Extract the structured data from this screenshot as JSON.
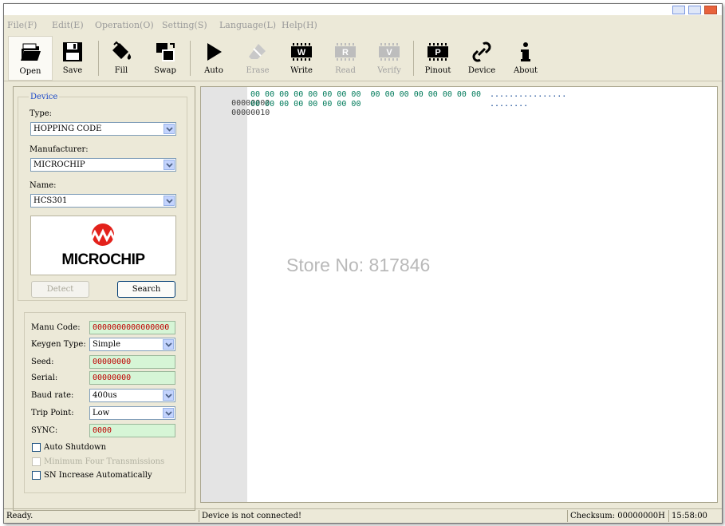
{
  "menu": {
    "items": [
      "File(F)",
      "Edit(E)",
      "Operation(O)",
      "Setting(S)",
      "Language(L)",
      "Help(H)"
    ]
  },
  "toolbar": {
    "buttons": [
      {
        "label": "Open",
        "icon": "folder-open-icon"
      },
      {
        "label": "Save",
        "icon": "floppy-disk-icon"
      },
      {
        "label": "Fill",
        "icon": "paint-bucket-icon"
      },
      {
        "label": "Swap",
        "icon": "swap-icon"
      },
      {
        "label": "Auto",
        "icon": "play-icon"
      },
      {
        "label": "Erase",
        "icon": "eraser-icon"
      },
      {
        "label": "Write",
        "icon": "chip-w-icon",
        "chip": "W"
      },
      {
        "label": "Read",
        "icon": "chip-r-icon",
        "chip": "R"
      },
      {
        "label": "Verify",
        "icon": "chip-v-icon",
        "chip": "V"
      },
      {
        "label": "Pinout",
        "icon": "chip-p-icon",
        "chip": "P"
      },
      {
        "label": "Device",
        "icon": "link-icon"
      },
      {
        "label": "About",
        "icon": "info-icon"
      }
    ]
  },
  "device": {
    "group_title": "Device",
    "type_label": "Type:",
    "type_value": "HOPPING CODE",
    "manufacturer_label": "Manufacturer:",
    "manufacturer_value": "MICROCHIP",
    "name_label": "Name:",
    "name_value": "HCS301",
    "logo_text": "MICROCHIP",
    "detect_label": "Detect",
    "search_label": "Search"
  },
  "params": {
    "manu_code_label": "Manu Code:",
    "manu_code_value": "0000000000000000",
    "keygen_label": "Keygen Type:",
    "keygen_value": "Simple",
    "seed_label": "Seed:",
    "seed_value": "00000000",
    "serial_label": "Serial:",
    "serial_value": "00000000",
    "baud_label": "Baud rate:",
    "baud_value": "400us",
    "trip_label": "Trip Point:",
    "trip_value": "Low",
    "sync_label": "SYNC:",
    "sync_value": "0000",
    "auto_shutdown": "Auto Shutdown",
    "min_four": "Minimum Four Transmissions",
    "sn_increase": "SN Increase Automatically"
  },
  "hex": {
    "rows": [
      {
        "addr": "00000000",
        "bytes": "00 00 00 00 00 00 00 00  00 00 00 00 00 00 00 00",
        "ascii": "................"
      },
      {
        "addr": "00000010",
        "bytes": "00 00 00 00 00 00 00 00",
        "ascii": "........"
      }
    ]
  },
  "watermark": "Store No: 817846",
  "status": {
    "left": "Ready.",
    "device": "Device is not connected!",
    "checksum": "Checksum: 00000000H",
    "time": "15:58:00"
  },
  "colors": {
    "window_bg": "#ece9d8",
    "hex_green": "#007a5a",
    "field_bg": "#d6f5d6",
    "field_text": "#c00000",
    "microchip_red": "#e3211b"
  }
}
